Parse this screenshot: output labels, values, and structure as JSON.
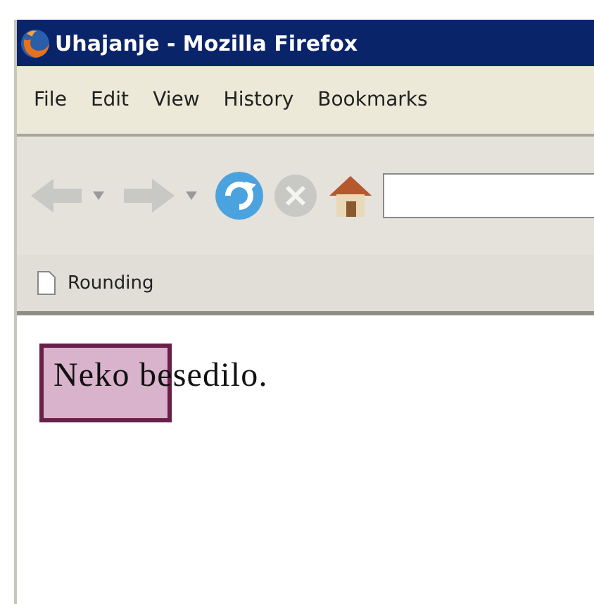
{
  "window": {
    "title": "Uhajanje - Mozilla Firefox"
  },
  "menu": [
    {
      "label": "File"
    },
    {
      "label": "Edit"
    },
    {
      "label": "View"
    },
    {
      "label": "History"
    },
    {
      "label": "Bookmarks"
    }
  ],
  "toolbar": {
    "back_disabled": true,
    "forward_disabled": true,
    "stop_disabled": true
  },
  "bookmarks": [
    {
      "label": "Rounding"
    }
  ],
  "content": {
    "text": "Neko besedilo."
  }
}
